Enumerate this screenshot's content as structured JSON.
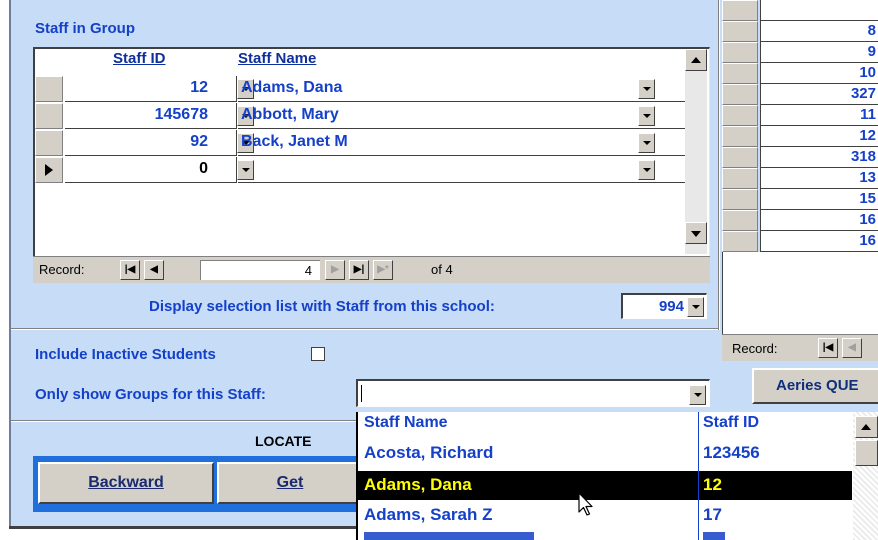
{
  "staff_group": {
    "title": "Staff in Group",
    "col_staff_id": "Staff ID",
    "col_staff_name": "Staff Name",
    "rows": [
      {
        "id": "12",
        "name": "Adams, Dana"
      },
      {
        "id": "145678",
        "name": "Abbott, Mary"
      },
      {
        "id": "92",
        "name": "Back, Janet M"
      },
      {
        "id": "0",
        "name": ""
      }
    ],
    "record_label": "Record:",
    "record_current": "4",
    "record_of": "of  4"
  },
  "school_selection": {
    "label": "Display selection list with Staff from this school:",
    "value": "994"
  },
  "include_inactive": {
    "label": "Include Inactive Students",
    "checked": false
  },
  "only_show_groups": {
    "label": "Only show Groups for this Staff:",
    "value": ""
  },
  "locate": {
    "title": "LOCATE",
    "backward": "Backward",
    "get": "Get"
  },
  "right_panel": {
    "values": [
      "8",
      "9",
      "10",
      "327",
      "11",
      "12",
      "318",
      "13",
      "15",
      "16",
      "16"
    ],
    "record_label": "Record:",
    "aeries_button": "Aeries QUE"
  },
  "staff_dropdown": {
    "col_name": "Staff Name",
    "col_id": "Staff ID",
    "items": [
      {
        "name": "Acosta, Richard",
        "id": "123456"
      },
      {
        "name": "Adams, Dana",
        "id": "12"
      },
      {
        "name": "Adams, Sarah Z",
        "id": "17"
      }
    ]
  },
  "colors": {
    "form_background": "#c6dcf7",
    "label_blue": "#1540c8",
    "selection_bg": "#000000",
    "selection_text": "#ffff00"
  }
}
